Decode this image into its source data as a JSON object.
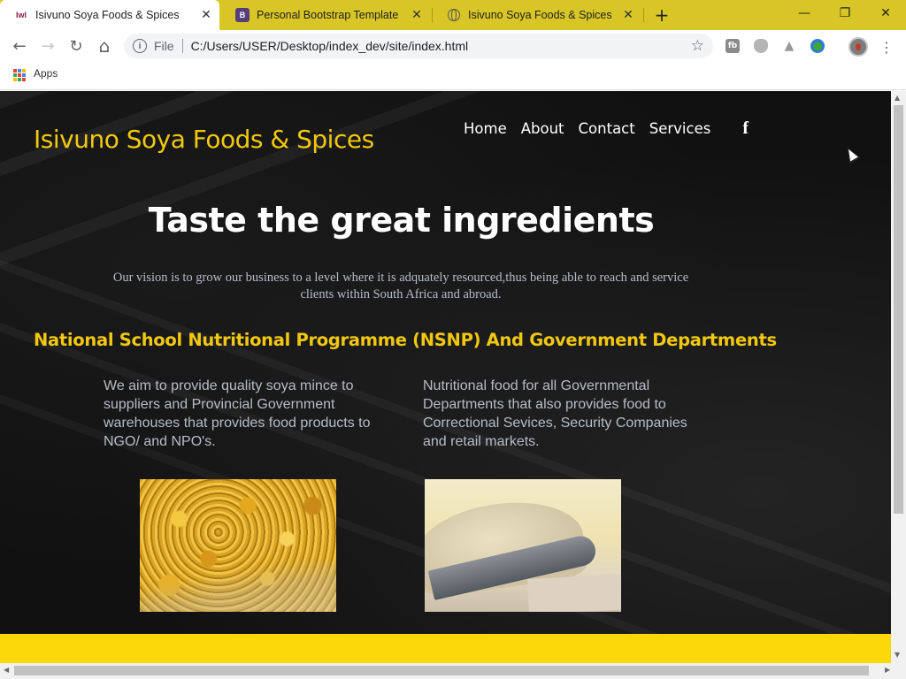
{
  "browser": {
    "tabs": [
      {
        "title": "Isivuno Soya Foods & Spices",
        "favicon": "site-logo-icon",
        "active": true
      },
      {
        "title": "Personal Bootstrap Template",
        "favicon": "bootstrap-icon",
        "favicon_text": "B",
        "active": false
      },
      {
        "title": "Isivuno Soya Foods & Spices",
        "favicon": "globe-icon",
        "active": false
      }
    ],
    "new_tab_label": "+",
    "window_buttons": {
      "minimize": "—",
      "restore": "❐",
      "close": "✕"
    },
    "nav": {
      "back": "←",
      "forward": "→",
      "reload": "↻",
      "home": "⌂"
    },
    "omnibox": {
      "info_glyph": "i",
      "scheme": "File",
      "url": "C:/Users/USER/Desktop/index_dev/site/index.html",
      "bookmark_star": "☆"
    },
    "extensions": [
      {
        "name": "fb-extension-icon",
        "glyph": "fb",
        "color": "#8a8a8a"
      },
      {
        "name": "shield-extension-icon",
        "glyph": "",
        "color": "#9a9a9a"
      },
      {
        "name": "drive-extension-icon",
        "glyph": "▲",
        "color": "#9a9a9a"
      },
      {
        "name": "globe-extension-icon",
        "glyph": "●",
        "color": "#3a8a3a"
      }
    ],
    "menu_glyph": "⋮",
    "bookmarks": {
      "apps_label": "Apps"
    }
  },
  "site": {
    "brand": "Isivuno Soya Foods & Spices",
    "nav": [
      "Home",
      "About",
      "Contact",
      "Services"
    ],
    "facebook_glyph": "f",
    "hero_title": "Taste the great ingredients",
    "vision": "Our vision is to grow our business to a level where it is adquately resourced,thus being able to reach and service clients within South Africa and abroad.",
    "section_title": "National School Nutritional Programme (NSNP) And Government Departments",
    "columns": [
      "We aim to provide quality soya mince to suppliers and Provincial Government warehouses that provides food products to NGO/ and NPO's.",
      "Nutritional food for all Governmental Departments that also provides food to Correctional Sevices, Security Companies and retail markets."
    ],
    "colors": {
      "brand_yellow": "#f2c80f",
      "footer_yellow": "#fcd709",
      "background": "#111111"
    }
  }
}
